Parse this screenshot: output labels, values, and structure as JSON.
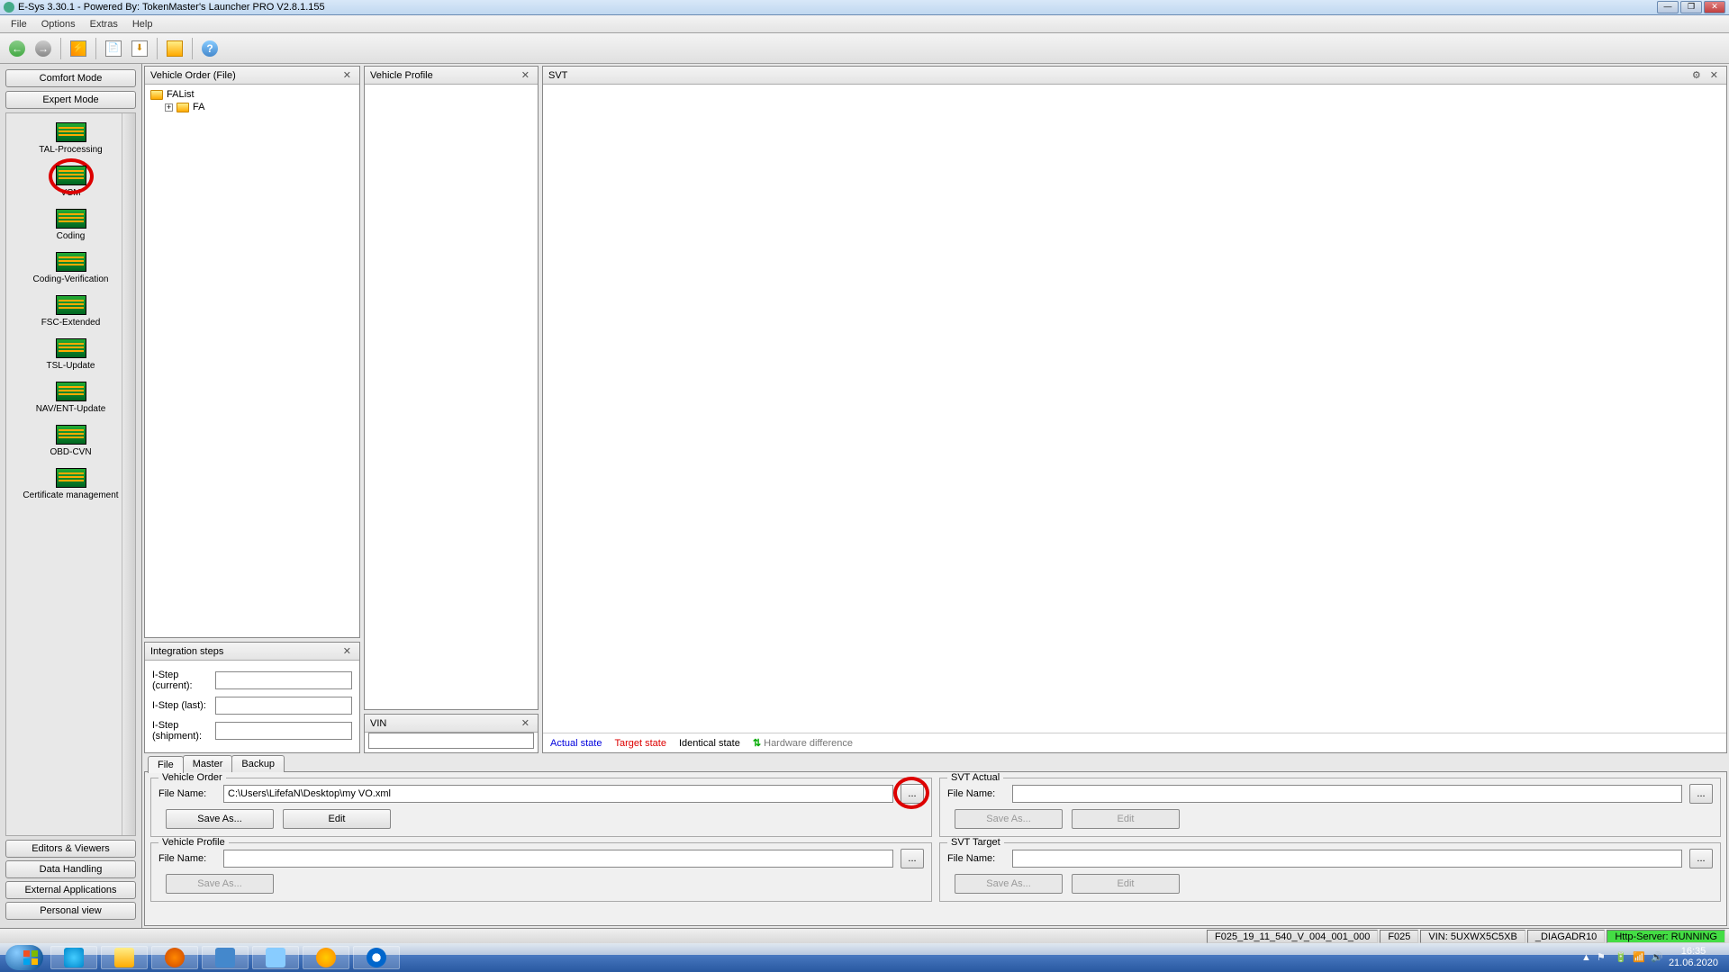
{
  "title": "E-Sys 3.30.1 - Powered By: TokenMaster's Launcher PRO V2.8.1.155",
  "menu": {
    "file": "File",
    "options": "Options",
    "extras": "Extras",
    "help": "Help"
  },
  "sidebar": {
    "modes": {
      "comfort": "Comfort Mode",
      "expert": "Expert Mode"
    },
    "items": [
      {
        "label": "TAL-Processing"
      },
      {
        "label": "VCM"
      },
      {
        "label": "Coding"
      },
      {
        "label": "Coding-Verification"
      },
      {
        "label": "FSC-Extended"
      },
      {
        "label": "TSL-Update"
      },
      {
        "label": "NAV/ENT-Update"
      },
      {
        "label": "OBD-CVN"
      },
      {
        "label": "Certificate management"
      }
    ],
    "bottom": [
      "Editors & Viewers",
      "Data Handling",
      "External Applications",
      "Personal view"
    ]
  },
  "panels": {
    "vehicle_order": {
      "title": "Vehicle Order (File)",
      "tree": {
        "root": "FAList",
        "child": "FA"
      }
    },
    "integration": {
      "title": "Integration steps",
      "current_label": "I-Step (current):",
      "last_label": "I-Step (last):",
      "shipment_label": "I-Step (shipment):",
      "current": "",
      "last": "",
      "shipment": ""
    },
    "vehicle_profile": {
      "title": "Vehicle Profile"
    },
    "vin": {
      "title": "VIN",
      "value": ""
    },
    "svt": {
      "title": "SVT",
      "legend": {
        "actual": "Actual state",
        "target": "Target state",
        "identical": "Identical state",
        "hw": "Hardware difference"
      }
    }
  },
  "tabs": {
    "file": "File",
    "master": "Master",
    "backup": "Backup"
  },
  "file_tab": {
    "vehicle_order": {
      "legend": "Vehicle Order",
      "file_label": "File Name:",
      "path": "C:\\Users\\LifefaN\\Desktop\\my VO.xml",
      "save_as": "Save As...",
      "edit": "Edit",
      "browse": "..."
    },
    "vehicle_profile": {
      "legend": "Vehicle Profile",
      "file_label": "File Name:",
      "path": "",
      "save_as": "Save As...",
      "browse": "..."
    },
    "svt_actual": {
      "legend": "SVT Actual",
      "file_label": "File Name:",
      "path": "",
      "save_as": "Save As...",
      "edit": "Edit",
      "browse": "..."
    },
    "svt_target": {
      "legend": "SVT Target",
      "file_label": "File Name:",
      "path": "",
      "save_as": "Save As...",
      "edit": "Edit",
      "browse": "..."
    }
  },
  "status": {
    "istep": "F025_19_11_540_V_004_001_000",
    "series": "F025",
    "vin": "VIN: 5UXWX5C5XB",
    "diag": "_DIAGADR10",
    "http": "Http-Server: RUNNING"
  },
  "taskbar": {
    "time": "16:35",
    "date": "21.06.2020"
  }
}
